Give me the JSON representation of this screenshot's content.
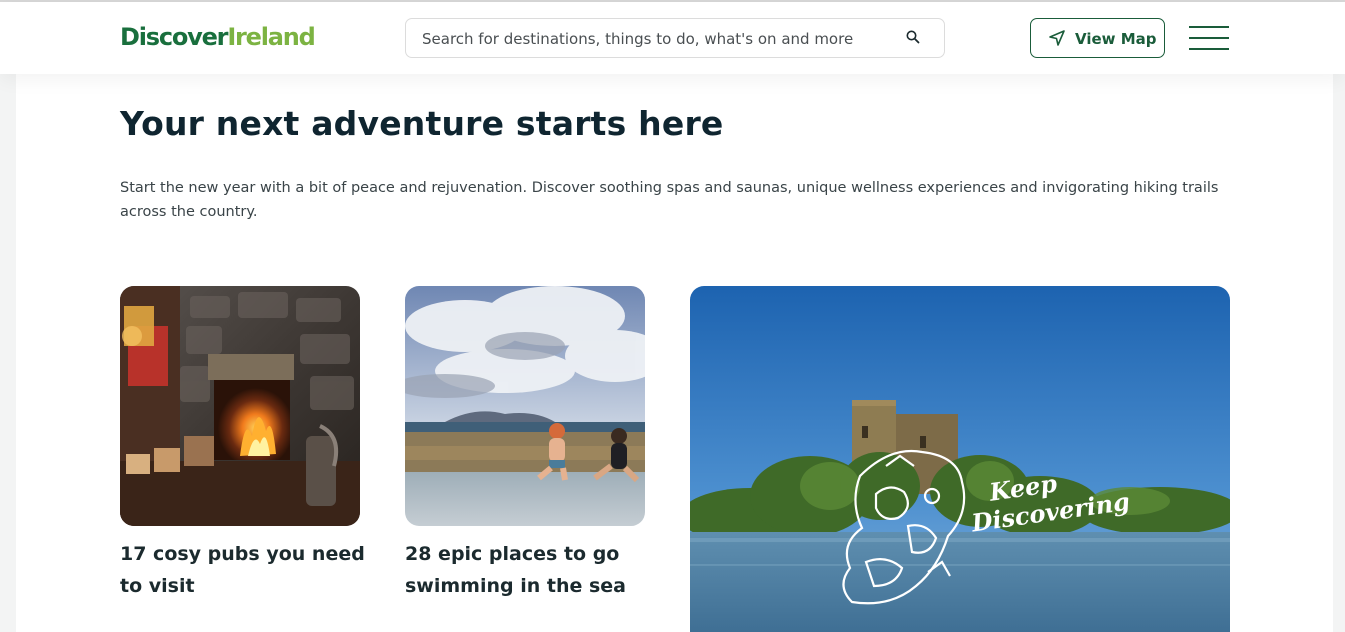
{
  "header": {
    "logo": {
      "part1": "Discover",
      "part2": "Ireland"
    },
    "search": {
      "placeholder": "Search for destinations, things to do, what's on and more"
    },
    "view_map_label": "View Map"
  },
  "hero": {
    "title": "Your next adventure starts here",
    "description": "Start the new year with a bit of peace and rejuvenation. Discover soothing spas and saunas, unique wellness experiences and invigorating hiking trails across the country."
  },
  "cards": [
    {
      "title": "17 cosy pubs you need to visit"
    },
    {
      "title": "28 epic places to go swimming in the sea"
    }
  ],
  "feature": {
    "line1": "Keep",
    "line2": "Discovering"
  },
  "colors": {
    "brand_dark": "#196f3d",
    "brand_light": "#7cb342",
    "accent": "#1a5c3a"
  }
}
